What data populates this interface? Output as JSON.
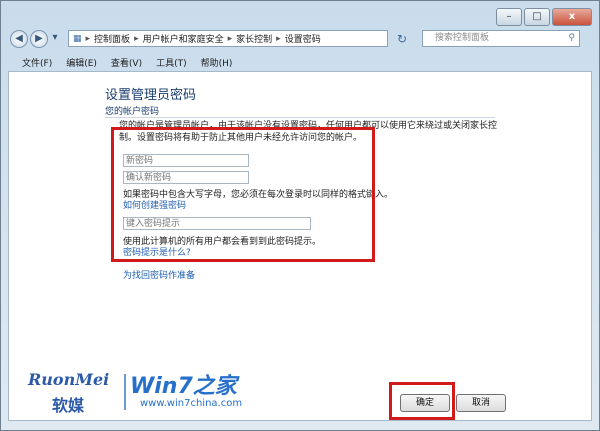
{
  "window": {
    "controls": [
      "–",
      "□",
      "x"
    ]
  },
  "address_bar": {
    "crumbs": [
      "控制面板",
      "用户帐户和家庭安全",
      "家长控制",
      "设置密码"
    ],
    "search_placeholder": "搜索控制面板"
  },
  "menu": [
    "文件(F)",
    "编辑(E)",
    "查看(V)",
    "工具(T)",
    "帮助(H)"
  ],
  "page": {
    "title": "设置管理员密码",
    "section_label": "您的帐户密码",
    "description": "您的帐户是管理员帐户，由于该帐户没有设置密码，任何用户都可以使用它来绕过或关闭家长控制。设置密码将有助于防止其他用户未经允许访问您的帐户。",
    "new_password_placeholder": "新密码",
    "confirm_password_placeholder": "确认新密码",
    "caps_note": "如果密码中包含大写字母，您必须在每次登录时以同样的格式键入。",
    "strong_password_link": "如何创建强密码",
    "hint_placeholder": "键入密码提示",
    "hint_note": "使用此计算机的所有用户都会看到到此密码提示。",
    "hint_link": "密码提示是什么?",
    "recovery_link": "为找回密码作准备"
  },
  "buttons": {
    "ok": "确定",
    "cancel": "取消"
  },
  "watermark": {
    "brand_latin": "RuonMei",
    "brand_cn": "软媒",
    "win7": "Win7之家",
    "site": "www.win7china.com"
  },
  "colors": {
    "highlight": "#d11a1a",
    "link": "#1f5fb0",
    "title": "#1a3e6e"
  }
}
